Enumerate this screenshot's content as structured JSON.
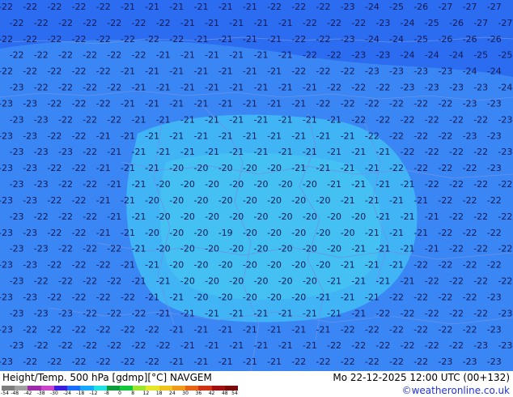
{
  "title": "Height/Temp. 500 hPa [gdmp][°C] NAVGEM",
  "valid_time": "Mo 22-12-2025 12:00 UTC (00+132)",
  "credit": "©weatheronline.co.uk",
  "colors": {
    "outer_field": "#2b6cf0",
    "mid_field": "#3a86f4",
    "inner_field": "#40b4f4",
    "core_field": "#45c0f2",
    "label_text": "#151a55",
    "border_lines": "#6a93e8",
    "credit_text": "#2233dd"
  },
  "colorbar": {
    "ticks": [
      "-54",
      "-48",
      "-42",
      "-38",
      "-30",
      "-24",
      "-18",
      "-12",
      "-8",
      "0",
      "8",
      "12",
      "18",
      "24",
      "30",
      "36",
      "42",
      "48",
      "54"
    ],
    "colors": [
      "#7d7d7d",
      "#a0a0a0",
      "#9b2ba8",
      "#cc44cc",
      "#3b1de0",
      "#1a6cff",
      "#14a8ff",
      "#1ee2e2",
      "#0c9b3c",
      "#14c83c",
      "#9ce62c",
      "#e6e629",
      "#f0c41c",
      "#f09a1c",
      "#e66414",
      "#d23214",
      "#a01010",
      "#7a0a0a"
    ]
  },
  "map_labels": [
    [
      "-22",
      "-22",
      "-22",
      "-22",
      "-22",
      "-21",
      "-21",
      "-21",
      "-21",
      "-21",
      "-21",
      "-22",
      "-22",
      "-22",
      "-23",
      "-24",
      "-25",
      "-26",
      "-27",
      "-27",
      "-27"
    ],
    [
      "-22",
      "-22",
      "-22",
      "-22",
      "-22",
      "-22",
      "-22",
      "-21",
      "-21",
      "-21",
      "-21",
      "-21",
      "-22",
      "-22",
      "-22",
      "-23",
      "-24",
      "-25",
      "-26",
      "-27",
      "-27"
    ],
    [
      "-22",
      "-22",
      "-22",
      "-22",
      "-22",
      "-22",
      "-22",
      "-22",
      "-21",
      "-21",
      "-21",
      "-21",
      "-22",
      "-22",
      "-23",
      "-24",
      "-24",
      "-25",
      "-26",
      "-26",
      "-26"
    ],
    [
      "-22",
      "-22",
      "-22",
      "-22",
      "-22",
      "-22",
      "-21",
      "-21",
      "-21",
      "-21",
      "-21",
      "-21",
      "-22",
      "-22",
      "-23",
      "-23",
      "-24",
      "-24",
      "-24",
      "-25",
      "-25"
    ],
    [
      "-22",
      "-22",
      "-22",
      "-22",
      "-22",
      "-21",
      "-21",
      "-21",
      "-21",
      "-21",
      "-21",
      "-21",
      "-22",
      "-22",
      "-22",
      "-23",
      "-23",
      "-23",
      "-23",
      "-24",
      "-24"
    ],
    [
      "-23",
      "-22",
      "-22",
      "-22",
      "-22",
      "-21",
      "-21",
      "-21",
      "-21",
      "-21",
      "-21",
      "-21",
      "-21",
      "-22",
      "-22",
      "-22",
      "-23",
      "-23",
      "-23",
      "-23",
      "-24"
    ],
    [
      "-23",
      "-23",
      "-22",
      "-22",
      "-22",
      "-21",
      "-21",
      "-21",
      "-21",
      "-21",
      "-21",
      "-21",
      "-21",
      "-22",
      "-22",
      "-22",
      "-22",
      "-22",
      "-22",
      "-23",
      "-23"
    ],
    [
      "-23",
      "-23",
      "-22",
      "-22",
      "-22",
      "-21",
      "-21",
      "-21",
      "-21",
      "-21",
      "-21",
      "-21",
      "-21",
      "-21",
      "-22",
      "-22",
      "-22",
      "-22",
      "-22",
      "-22",
      "-23"
    ],
    [
      "-23",
      "-23",
      "-22",
      "-22",
      "-21",
      "-21",
      "-21",
      "-21",
      "-21",
      "-21",
      "-21",
      "-21",
      "-21",
      "-21",
      "-21",
      "-22",
      "-22",
      "-22",
      "-22",
      "-23",
      "-23"
    ],
    [
      "-23",
      "-23",
      "-23",
      "-22",
      "-21",
      "-21",
      "-21",
      "-21",
      "-21",
      "-21",
      "-21",
      "-21",
      "-21",
      "-21",
      "-21",
      "-21",
      "-22",
      "-22",
      "-22",
      "-22",
      "-23"
    ],
    [
      "-23",
      "-23",
      "-22",
      "-22",
      "-21",
      "-21",
      "-21",
      "-20",
      "-20",
      "-20",
      "-20",
      "-20",
      "-21",
      "-21",
      "-21",
      "-21",
      "-22",
      "-22",
      "-22",
      "-22",
      "-23"
    ],
    [
      "-23",
      "-23",
      "-22",
      "-22",
      "-21",
      "-21",
      "-20",
      "-20",
      "-20",
      "-20",
      "-20",
      "-20",
      "-20",
      "-21",
      "-21",
      "-21",
      "-21",
      "-22",
      "-22",
      "-22",
      "-22"
    ],
    [
      "-23",
      "-23",
      "-22",
      "-22",
      "-21",
      "-21",
      "-20",
      "-20",
      "-20",
      "-20",
      "-20",
      "-20",
      "-20",
      "-20",
      "-21",
      "-21",
      "-21",
      "-21",
      "-22",
      "-22",
      "-22"
    ],
    [
      "-23",
      "-22",
      "-22",
      "-22",
      "-21",
      "-21",
      "-20",
      "-20",
      "-20",
      "-20",
      "-20",
      "-20",
      "-20",
      "-20",
      "-20",
      "-21",
      "-21",
      "-21",
      "-22",
      "-22",
      "-22"
    ],
    [
      "-23",
      "-23",
      "-22",
      "-22",
      "-21",
      "-21",
      "-20",
      "-20",
      "-20",
      "-19",
      "-20",
      "-20",
      "-20",
      "-20",
      "-20",
      "-21",
      "-21",
      "-21",
      "-22",
      "-22",
      "-22"
    ],
    [
      "-23",
      "-23",
      "-22",
      "-22",
      "-22",
      "-21",
      "-20",
      "-20",
      "-20",
      "-20",
      "-20",
      "-20",
      "-20",
      "-20",
      "-21",
      "-21",
      "-21",
      "-21",
      "-22",
      "-22",
      "-22"
    ],
    [
      "-23",
      "-23",
      "-22",
      "-22",
      "-22",
      "-21",
      "-21",
      "-20",
      "-20",
      "-20",
      "-20",
      "-20",
      "-20",
      "-20",
      "-21",
      "-21",
      "-21",
      "-22",
      "-22",
      "-22",
      "-22"
    ],
    [
      "-23",
      "-22",
      "-22",
      "-22",
      "-22",
      "-21",
      "-21",
      "-20",
      "-20",
      "-20",
      "-20",
      "-20",
      "-20",
      "-21",
      "-21",
      "-21",
      "-21",
      "-22",
      "-22",
      "-22",
      "-22"
    ],
    [
      "-23",
      "-23",
      "-22",
      "-22",
      "-22",
      "-22",
      "-21",
      "-21",
      "-20",
      "-20",
      "-20",
      "-20",
      "-20",
      "-21",
      "-21",
      "-21",
      "-22",
      "-22",
      "-22",
      "-22",
      "-23"
    ],
    [
      "-23",
      "-23",
      "-23",
      "-22",
      "-22",
      "-22",
      "-21",
      "-21",
      "-21",
      "-21",
      "-21",
      "-21",
      "-21",
      "-21",
      "-21",
      "-22",
      "-22",
      "-22",
      "-22",
      "-22",
      "-23"
    ],
    [
      "-23",
      "-22",
      "-22",
      "-22",
      "-22",
      "-22",
      "-22",
      "-21",
      "-21",
      "-21",
      "-21",
      "-21",
      "-21",
      "-21",
      "-22",
      "-22",
      "-22",
      "-22",
      "-22",
      "-22",
      "-23"
    ],
    [
      "-23",
      "-22",
      "-22",
      "-22",
      "-22",
      "-22",
      "-22",
      "-21",
      "-21",
      "-21",
      "-21",
      "-21",
      "-21",
      "-22",
      "-22",
      "-22",
      "-22",
      "-22",
      "-22",
      "-23",
      "-23"
    ],
    [
      "-23",
      "-22",
      "-22",
      "-22",
      "-22",
      "-22",
      "-22",
      "-21",
      "-21",
      "-21",
      "-21",
      "-21",
      "-22",
      "-22",
      "-22",
      "-22",
      "-22",
      "-22",
      "-23",
      "-23",
      "-23"
    ]
  ]
}
